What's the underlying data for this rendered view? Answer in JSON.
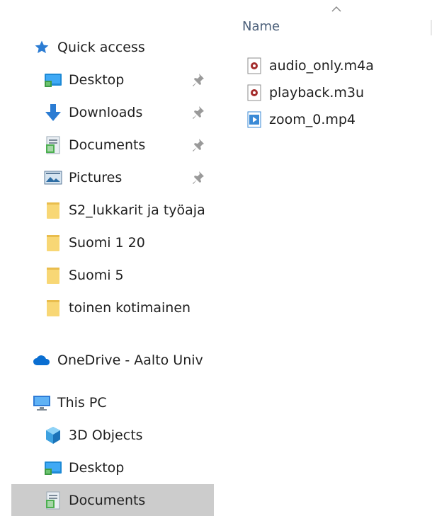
{
  "navigation": {
    "quick_access": {
      "label": "Quick access",
      "items": [
        {
          "label": "Desktop",
          "icon": "desktop-folder-icon",
          "pinned": true
        },
        {
          "label": "Downloads",
          "icon": "downloads-arrow-icon",
          "pinned": true
        },
        {
          "label": "Documents",
          "icon": "documents-icon",
          "pinned": true
        },
        {
          "label": "Pictures",
          "icon": "pictures-icon",
          "pinned": true
        },
        {
          "label": "S2_lukkarit ja työaja",
          "icon": "folder-icon",
          "pinned": false
        },
        {
          "label": "Suomi 1 20",
          "icon": "folder-icon",
          "pinned": false
        },
        {
          "label": "Suomi 5",
          "icon": "folder-icon",
          "pinned": false
        },
        {
          "label": "toinen kotimainen",
          "icon": "folder-icon",
          "pinned": false
        }
      ]
    },
    "onedrive": {
      "label": "OneDrive - Aalto Univ",
      "icon": "onedrive-cloud-icon"
    },
    "this_pc": {
      "label": "This PC",
      "icon": "computer-monitor-icon",
      "items": [
        {
          "label": "3D Objects",
          "icon": "3d-objects-icon"
        },
        {
          "label": "Desktop",
          "icon": "desktop-folder-icon"
        },
        {
          "label": "Documents",
          "icon": "documents-icon",
          "selected": true
        }
      ]
    }
  },
  "content": {
    "column_header": "Name",
    "sort_direction": "ascending",
    "files": [
      {
        "name": "audio_only.m4a",
        "icon": "audio-file-icon"
      },
      {
        "name": "playback.m3u",
        "icon": "audio-file-icon"
      },
      {
        "name": "zoom_0.mp4",
        "icon": "video-file-icon"
      }
    ]
  },
  "colors": {
    "selection": "#cccccc",
    "header_text": "#4c607a",
    "folder_yellow": "#f8d775",
    "quick_access_star": "#2b7cd3"
  }
}
